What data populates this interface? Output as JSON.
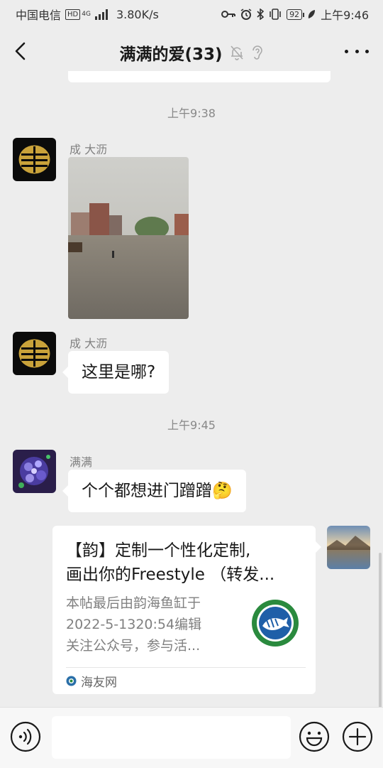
{
  "status_bar": {
    "carrier": "中国电信",
    "network": "HD",
    "net_type": "4G",
    "speed": "3.80K/s",
    "battery": "92",
    "time": "上午9:46"
  },
  "header": {
    "title": "满满的爱(33)",
    "back_icon": "chevron-left-icon",
    "mute_icon": "bell-off-icon",
    "listen_icon": "ear-icon",
    "more_icon": "more-icon"
  },
  "messages": [
    {
      "type": "time",
      "text": "上午9:38"
    },
    {
      "type": "image",
      "sender": "成 大沥",
      "side": "left"
    },
    {
      "type": "text",
      "sender": "成 大沥",
      "text": "这里是哪?",
      "side": "left"
    },
    {
      "type": "time",
      "text": "上午9:45"
    },
    {
      "type": "text",
      "sender": "满满",
      "text": "个个都想进门蹭蹭",
      "emoji": "🤔",
      "side": "left"
    },
    {
      "type": "link_card",
      "side": "right",
      "title_line1": "【韵】定制一个性化定制,",
      "title_line2": "画出你的Freestyle （转发...",
      "desc_line1": "本帖最后由韵海鱼缸于",
      "desc_line2": "2022-5-1320:54编辑",
      "desc_line3": "关注公众号，参与活...",
      "source": "海友网"
    }
  ],
  "input_bar": {
    "voice_icon": "voice-icon",
    "emoji_icon": "emoji-icon",
    "plus_icon": "plus-icon",
    "placeholder": ""
  },
  "colors": {
    "background": "#ededed",
    "bubble": "#ffffff",
    "muted_text": "#808080"
  }
}
